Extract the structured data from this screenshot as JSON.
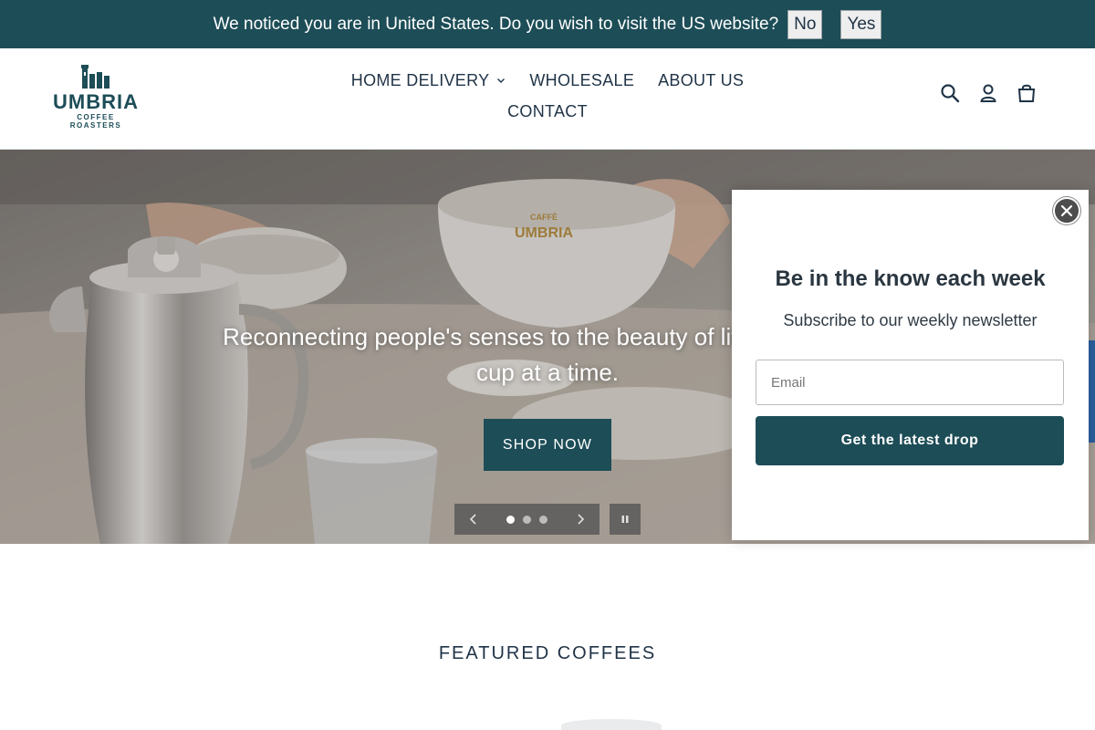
{
  "geo_banner": {
    "message": "We noticed you are in United States. Do you wish to visit the US website?",
    "no_label": "No",
    "yes_label": "Yes",
    "background": "#1d4d57"
  },
  "header": {
    "logo": {
      "name": "UMBRIA",
      "tagline": "COFFEE ROASTERS"
    },
    "nav": {
      "items": [
        {
          "label": "HOME DELIVERY",
          "has_dropdown": true
        },
        {
          "label": "WHOLESALE"
        },
        {
          "label": "ABOUT US"
        },
        {
          "label": "CONTACT"
        }
      ]
    },
    "icons": [
      "search-icon",
      "account-icon",
      "cart-icon"
    ]
  },
  "hero": {
    "headline": "Reconnecting people's senses to the beauty of life by providin",
    "headline_line2": "cup at a time.",
    "cup_brand_small": "CAFFÈ",
    "cup_brand": "UMBRIA",
    "cta_label": "SHOP NOW",
    "slides_total": 3,
    "active_slide": 1
  },
  "popup": {
    "title": "Be in the know each week",
    "subtitle": "Subscribe to our weekly newsletter",
    "email_placeholder": "Email",
    "submit_label": "Get the latest drop"
  },
  "featured": {
    "title": "FEATURED COFFEES"
  },
  "colors": {
    "brand": "#1d4d57",
    "text": "#1f3346",
    "side_tab": "#2b5f9e"
  }
}
